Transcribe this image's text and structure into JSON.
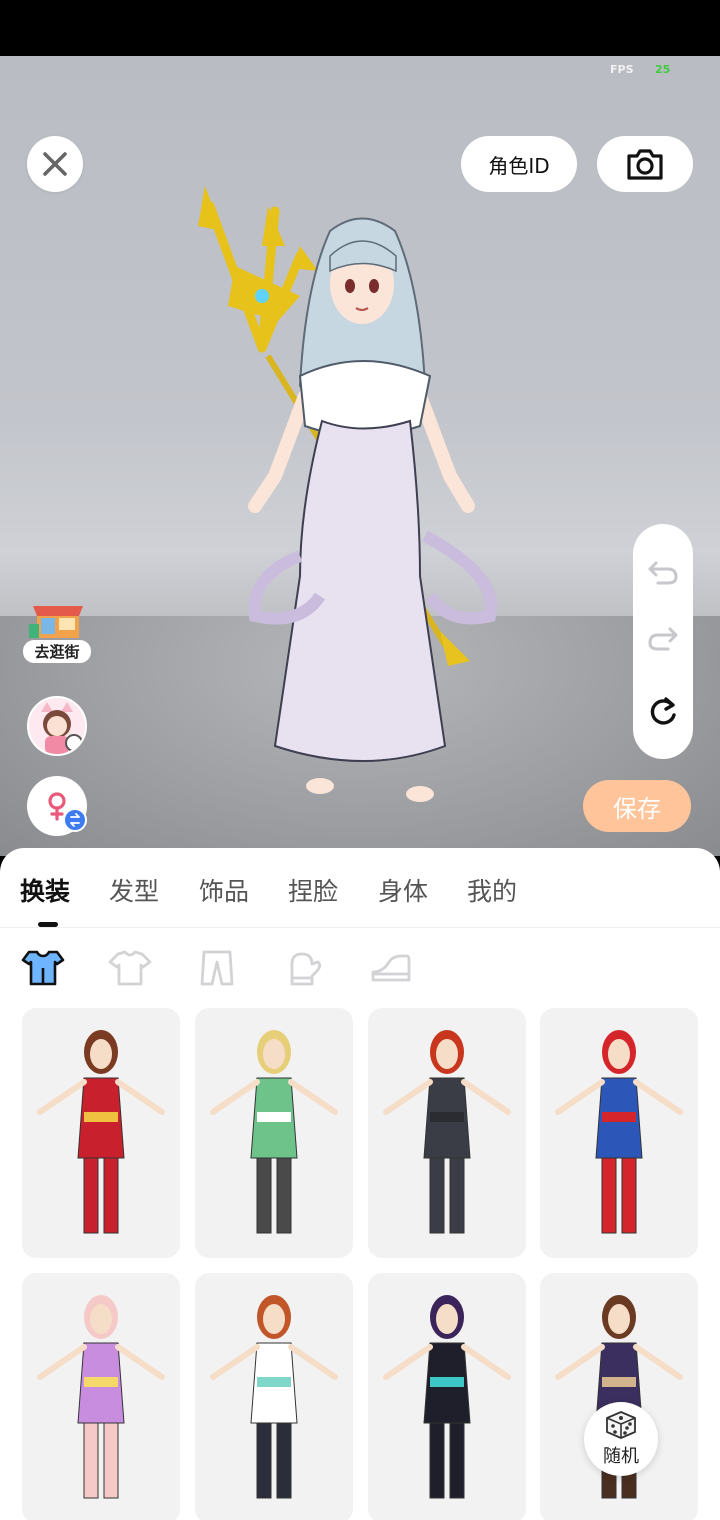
{
  "fps": {
    "label": "FPS",
    "value": "25"
  },
  "top_actions": {
    "role_id_label": "角色ID"
  },
  "left_actions": {
    "shop_label": "去逛街"
  },
  "save_label": "保存",
  "tabs": [
    {
      "label": "换装",
      "active": true
    },
    {
      "label": "发型",
      "active": false
    },
    {
      "label": "饰品",
      "active": false
    },
    {
      "label": "捏脸",
      "active": false
    },
    {
      "label": "身体",
      "active": false
    },
    {
      "label": "我的",
      "active": false
    }
  ],
  "subcategories": [
    {
      "icon": "outfit-set-icon",
      "active": true
    },
    {
      "icon": "top-icon",
      "active": false
    },
    {
      "icon": "pants-icon",
      "active": false
    },
    {
      "icon": "glove-icon",
      "active": false
    },
    {
      "icon": "shoe-icon",
      "active": false
    }
  ],
  "outfits": [
    {
      "icon": "outfit-wonder-hero",
      "hair": "#7a3b22",
      "body": "#c8202c",
      "accent": "#f0c040",
      "legs": "#c8202c"
    },
    {
      "icon": "outfit-green-kimono",
      "hair": "#e7cf7a",
      "body": "#6ec38a",
      "accent": "#ffffff",
      "legs": "#4a4a4a"
    },
    {
      "icon": "outfit-black-suit",
      "hair": "#c8361e",
      "body": "#3a3d45",
      "accent": "#2a2c31",
      "legs": "#3a3d45"
    },
    {
      "icon": "outfit-captain-hero",
      "hair": "#d4262a",
      "body": "#2c56b8",
      "accent": "#d4262a",
      "legs": "#d4262a"
    },
    {
      "icon": "outfit-pink-cat",
      "hair": "#f6c9c9",
      "body": "#c98de0",
      "accent": "#f5d86a",
      "legs": "#f6c9c9"
    },
    {
      "icon": "outfit-sport-jersey",
      "hair": "#c0562a",
      "body": "#ffffff",
      "accent": "#7ed7c8",
      "legs": "#2a2e3a"
    },
    {
      "icon": "outfit-gothic-dress",
      "hair": "#3a245a",
      "body": "#1e1f2a",
      "accent": "#3ec7c7",
      "legs": "#1e1f2a"
    },
    {
      "icon": "outfit-wizard-robe",
      "hair": "#6b3a22",
      "body": "#3a2f5e",
      "accent": "#d2b48c",
      "legs": "#4a2f20"
    }
  ],
  "random_label": "随机",
  "colors": {
    "save_bg": "#ffc49a",
    "badge_blue": "#3d7bf0",
    "gender_pink": "#e8597a",
    "fps_green": "#3ecb3e"
  }
}
